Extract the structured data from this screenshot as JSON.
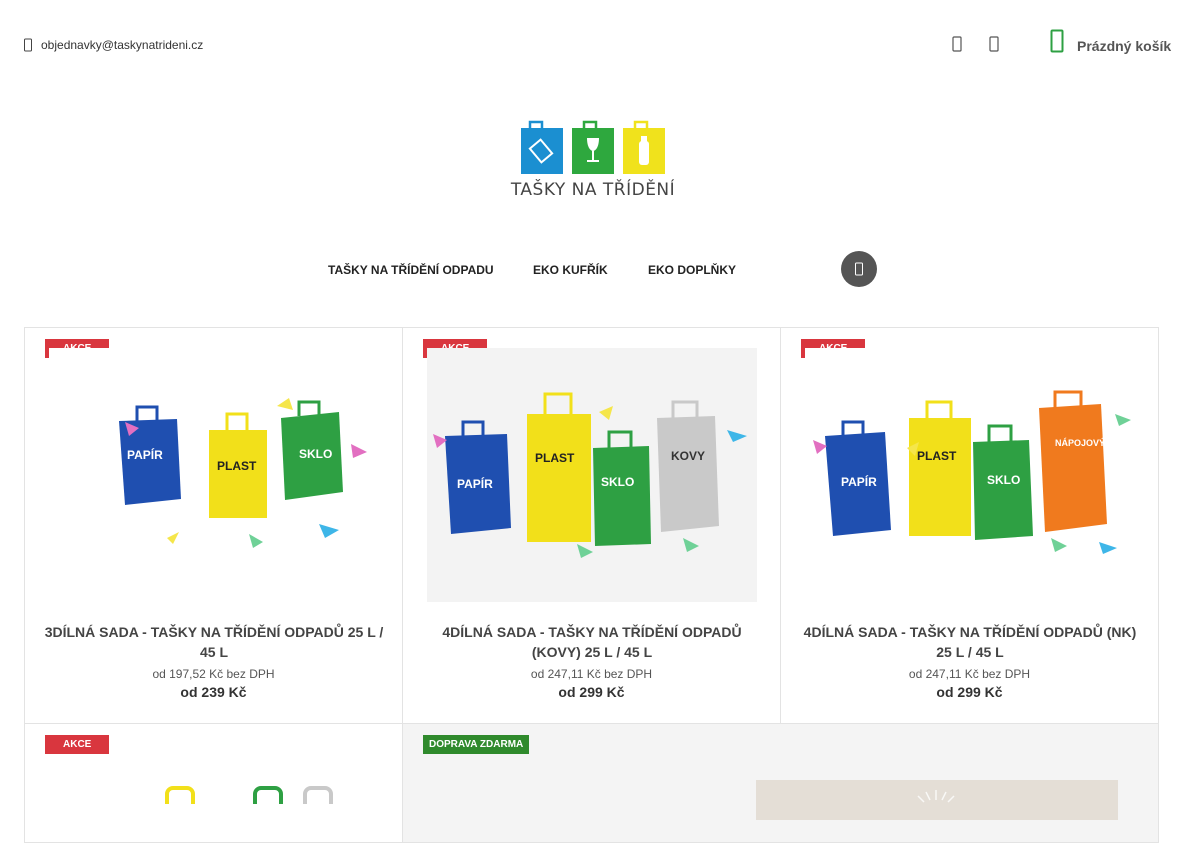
{
  "header": {
    "email": "objednavky@taskynatrideni.cz",
    "cart_label": "Prázdný košík",
    "icons": [
      "mail-icon",
      "user-icon",
      "heart-icon",
      "cart-icon"
    ]
  },
  "logo": {
    "text": "TAŠKY NA TŘÍDĚNÍ",
    "colors": [
      "#1b8fd1",
      "#2ea83e",
      "#f0e21c"
    ]
  },
  "nav": {
    "items": [
      "TAŠKY NA TŘÍDĚNÍ ODPADU",
      "EKO KUFŘÍK",
      "EKO DOPLŇKY"
    ],
    "search_icon": "search-icon"
  },
  "products": [
    {
      "badge": "AKCE",
      "name": "3DÍLNÁ SADA - TAŠKY NA TŘÍDĚNÍ ODPADŮ 25 L / 45 L",
      "net_price": "od 197,52 Kč bez DPH",
      "price": "od 239 Kč",
      "bag_labels": [
        "PAPÍR",
        "PLAST",
        "SKLO"
      ]
    },
    {
      "badge": "AKCE",
      "name": "4DÍLNÁ SADA - TAŠKY NA TŘÍDĚNÍ ODPADŮ (KOVY) 25 L / 45 L",
      "net_price": "od 247,11 Kč bez DPH",
      "price": "od 299 Kč",
      "bag_labels": [
        "PAPÍR",
        "PLAST",
        "SKLO",
        "KOVY"
      ]
    },
    {
      "badge": "AKCE",
      "name": "4DÍLNÁ SADA - TAŠKY NA TŘÍDĚNÍ ODPADŮ (NK) 25 L / 45 L",
      "net_price": "od 247,11 Kč bez DPH",
      "price": "od 299 Kč",
      "bag_labels": [
        "PAPÍR",
        "PLAST",
        "SKLO",
        "NÁPOJOVÝ KARTON"
      ]
    },
    {
      "badge": "AKCE"
    },
    {
      "badge": "DOPRAVA ZDARMA"
    }
  ],
  "colors": {
    "badge_red": "#d9363e",
    "badge_green": "#2f8a2c",
    "bag_blue": "#1f4fb0",
    "bag_yellow": "#f2e01a",
    "bag_green": "#2ea043",
    "bag_grey": "#c9c9c9",
    "bag_orange": "#f07a1e"
  }
}
